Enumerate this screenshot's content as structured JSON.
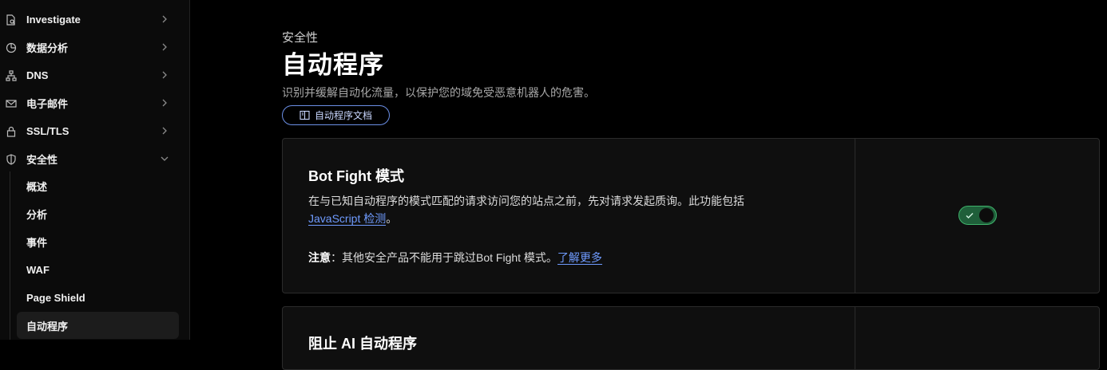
{
  "sidebar": {
    "items": [
      {
        "label": "Investigate",
        "icon": "investigate-icon"
      },
      {
        "label": "数据分析",
        "icon": "pie-chart-icon"
      },
      {
        "label": "DNS",
        "icon": "network-icon"
      },
      {
        "label": "电子邮件",
        "icon": "email-icon"
      },
      {
        "label": "SSL/TLS",
        "icon": "lock-icon"
      },
      {
        "label": "安全性",
        "icon": "shield-icon"
      }
    ],
    "security_subitems": [
      "概述",
      "分析",
      "事件",
      "WAF",
      "Page Shield",
      "自动程序"
    ],
    "active_subitem": "自动程序"
  },
  "main": {
    "eyebrow": "安全性",
    "title": "自动程序",
    "description": "识别并缓解自动化流量，以保护您的域免受恶意机器人的危害。",
    "doc_button": "自动程序文档"
  },
  "bot_fight_card": {
    "title": "Bot Fight 模式",
    "description": "在与已知自动程序的模式匹配的请求访问您的站点之前，先对请求发起质询。此功能包括",
    "description_link": "JavaScript 检测",
    "description_end": "。",
    "note_label": "注意",
    "note_text": "：其他安全产品不能用于跳过Bot Fight 模式。",
    "note_link": "了解更多",
    "toggle_state": "on"
  },
  "ai_card": {
    "title": "阻止 AI 自动程序"
  },
  "colors": {
    "accent_link": "#6f9bff",
    "toggle_on": "#3fb36b"
  }
}
